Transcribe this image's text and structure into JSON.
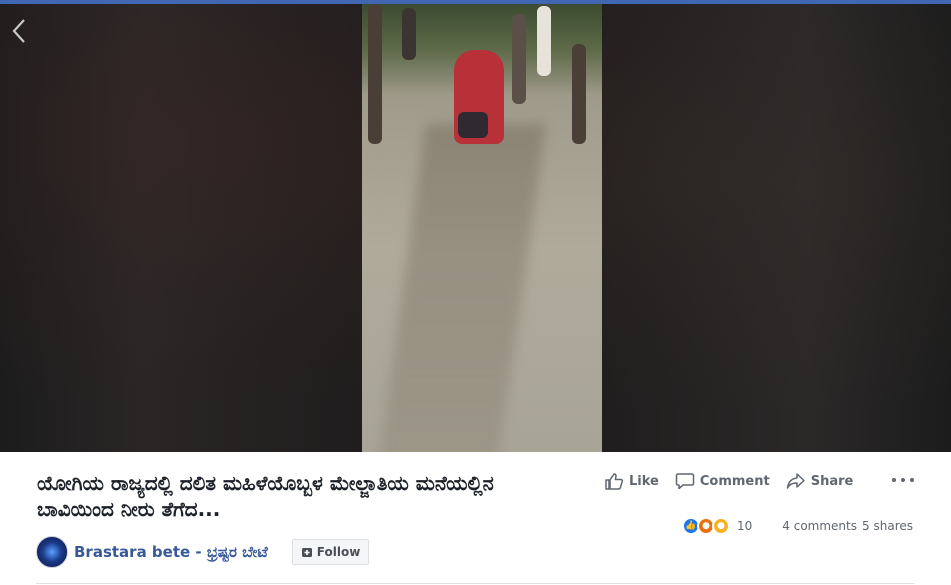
{
  "post": {
    "title": "ಯೋಗಿಯ ರಾಜ್ಯದಲ್ಲಿ ದಲಿತ ಮಹಿಳೆಯೊಬ್ಬಳ ಮೇಲ್ಜಾತಿಯ ಮನೆಯಲ್ಲಿನ ಬಾವಿಯಿಂದ ನೀರು ತೆಗೆದ...",
    "author": "Brastara bete - ಭ್ರಷ್ಟರ ಬೇಟೆ",
    "follow_label": "Follow"
  },
  "actions": {
    "like_label": "Like",
    "comment_label": "Comment",
    "share_label": "Share"
  },
  "stats": {
    "reactions_count": "10",
    "comments": "4 comments",
    "shares": "5 shares"
  },
  "colors": {
    "accent": "#4267b2",
    "link": "#385898",
    "text_secondary": "#606770"
  },
  "icons": [
    "back-arrow-icon",
    "like-icon",
    "comment-icon",
    "share-icon",
    "more-options-icon",
    "follow-icon"
  ]
}
